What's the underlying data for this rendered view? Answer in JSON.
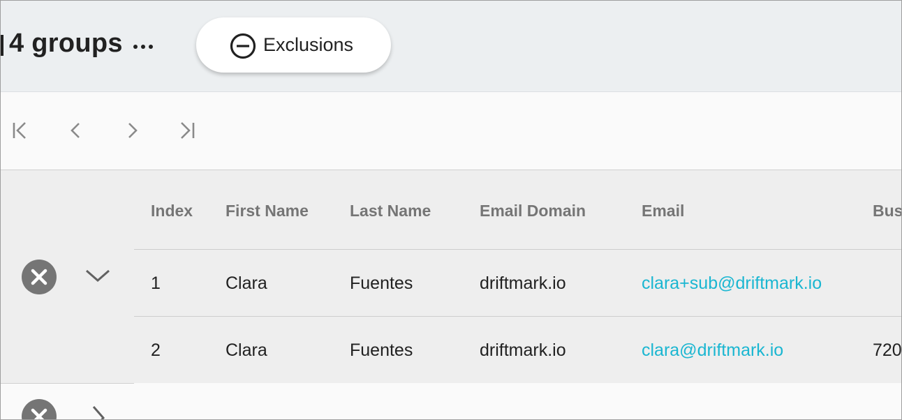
{
  "header": {
    "title": "4 groups",
    "exclusions_label": "Exclusions",
    "icons": {
      "more": "more-horizontal-icon",
      "exclusions": "minus-circle-icon"
    }
  },
  "pagination": {
    "icons": [
      "first-page-icon",
      "previous-page-icon",
      "next-page-icon",
      "last-page-icon"
    ]
  },
  "table": {
    "columns": [
      "Index",
      "First Name",
      "Last Name",
      "Email Domain",
      "Email",
      "Bus"
    ],
    "rows": [
      {
        "index": "1",
        "first_name": "Clara",
        "last_name": "Fuentes",
        "email_domain": "driftmark.io",
        "email": "clara+sub@driftmark.io",
        "bus": ""
      },
      {
        "index": "2",
        "first_name": "Clara",
        "last_name": "Fuentes",
        "email_domain": "driftmark.io",
        "email": "clara@driftmark.io",
        "bus": "720"
      }
    ]
  },
  "colors": {
    "link": "#1ab6d1",
    "header_bg": "#eceff1",
    "group_bg": "#eeeeee",
    "icon_gray": "#757575"
  }
}
